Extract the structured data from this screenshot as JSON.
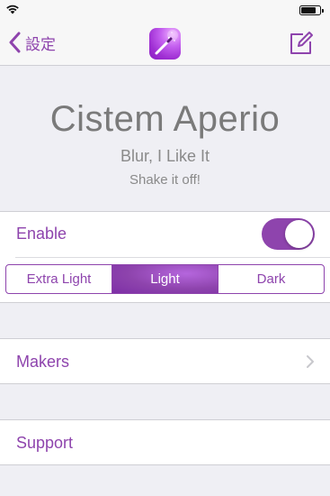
{
  "status_bar": {
    "icons": [
      "wifi-icon",
      "battery-icon"
    ]
  },
  "nav_bar": {
    "back_label": "設定",
    "app_icon": "wand-app-icon",
    "compose_icon": "compose-icon"
  },
  "header": {
    "title": "Cistem Aperio",
    "subtitle": "Blur, I Like It",
    "tagline": "Shake it off!"
  },
  "settings": {
    "enable_label": "Enable",
    "enable_on": true,
    "segments": [
      "Extra Light",
      "Light",
      "Dark"
    ],
    "selected_segment": "Light"
  },
  "rows": [
    {
      "label": "Makers",
      "has_disclosure": true
    },
    {
      "label": "Support",
      "has_disclosure": false
    }
  ],
  "colors": {
    "accent": "#8e44ad",
    "background": "#efeff4",
    "title_gray": "#7a7a7a"
  }
}
